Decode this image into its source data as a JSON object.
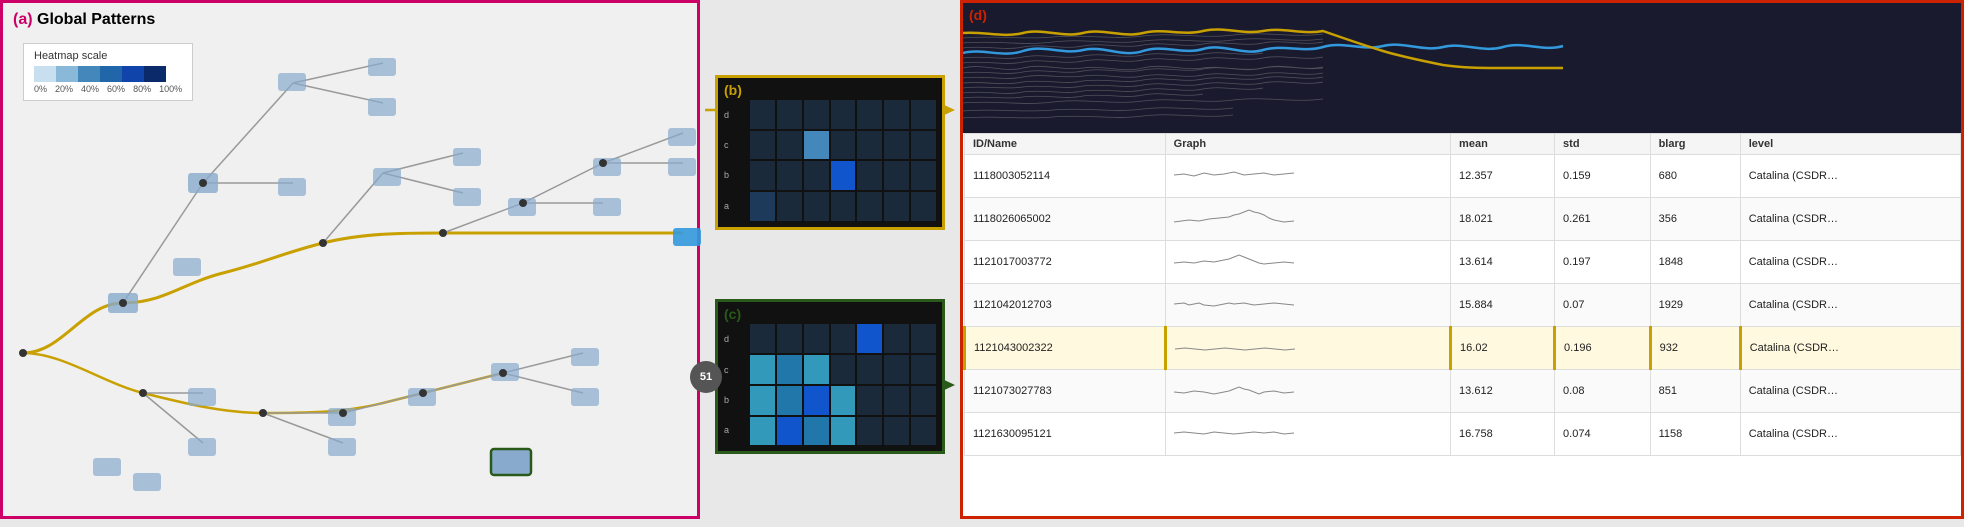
{
  "panels": {
    "a": {
      "label": "(a)",
      "title": "Global Patterns",
      "heatmap_scale": {
        "title": "Heatmap scale",
        "labels": [
          "0%",
          "20%",
          "40%",
          "60%",
          "80%",
          "100%"
        ],
        "colors": [
          "#c8dff0",
          "#8ab8d8",
          "#4488bb",
          "#2266aa",
          "#1144aa",
          "#0a2a6a"
        ]
      }
    },
    "b": {
      "label": "(b)",
      "row_labels": [
        "d",
        "c",
        "b",
        "a"
      ],
      "grid": [
        [
          0,
          0,
          0,
          0,
          0,
          0,
          0
        ],
        [
          0,
          0,
          2,
          0,
          0,
          0,
          0
        ],
        [
          0,
          0,
          0,
          3,
          0,
          0,
          0
        ],
        [
          1,
          0,
          0,
          0,
          0,
          0,
          0
        ]
      ]
    },
    "c": {
      "label": "(c)",
      "badge": "51",
      "row_labels": [
        "d",
        "c",
        "b",
        "a"
      ],
      "grid": [
        [
          0,
          0,
          0,
          0,
          4,
          0,
          0
        ],
        [
          1,
          2,
          1,
          0,
          0,
          0,
          0
        ],
        [
          1,
          2,
          3,
          1,
          0,
          0,
          0
        ],
        [
          1,
          3,
          2,
          1,
          0,
          0,
          0
        ]
      ]
    },
    "d": {
      "label": "(d)",
      "table": {
        "headers": [
          "ID/Name",
          "Graph",
          "mean",
          "std",
          "blarg",
          "level"
        ],
        "rows": [
          {
            "id": "1118003052114",
            "mean": "12.357",
            "std": "0.159",
            "blarg": "680",
            "level": "Catalina (CSDR…"
          },
          {
            "id": "1118026065002",
            "mean": "18.021",
            "std": "0.261",
            "blarg": "356",
            "level": "Catalina (CSDR…"
          },
          {
            "id": "1121017003772",
            "mean": "13.614",
            "std": "0.197",
            "blarg": "1848",
            "level": "Catalina (CSDR…"
          },
          {
            "id": "1121042012703",
            "mean": "15.884",
            "std": "0.07",
            "blarg": "1929",
            "level": "Catalina (CSDR…"
          },
          {
            "id": "1121043002322",
            "mean": "16.02",
            "std": "0.196",
            "blarg": "932",
            "level": "Catalina (CSDR…",
            "highlighted": true
          },
          {
            "id": "1121073027783",
            "mean": "13.612",
            "std": "0.08",
            "blarg": "851",
            "level": "Catalina (CSDR…"
          },
          {
            "id": "1121630095121",
            "mean": "16.758",
            "std": "0.074",
            "blarg": "1158",
            "level": "Catalina (CSDR…"
          }
        ]
      }
    }
  }
}
